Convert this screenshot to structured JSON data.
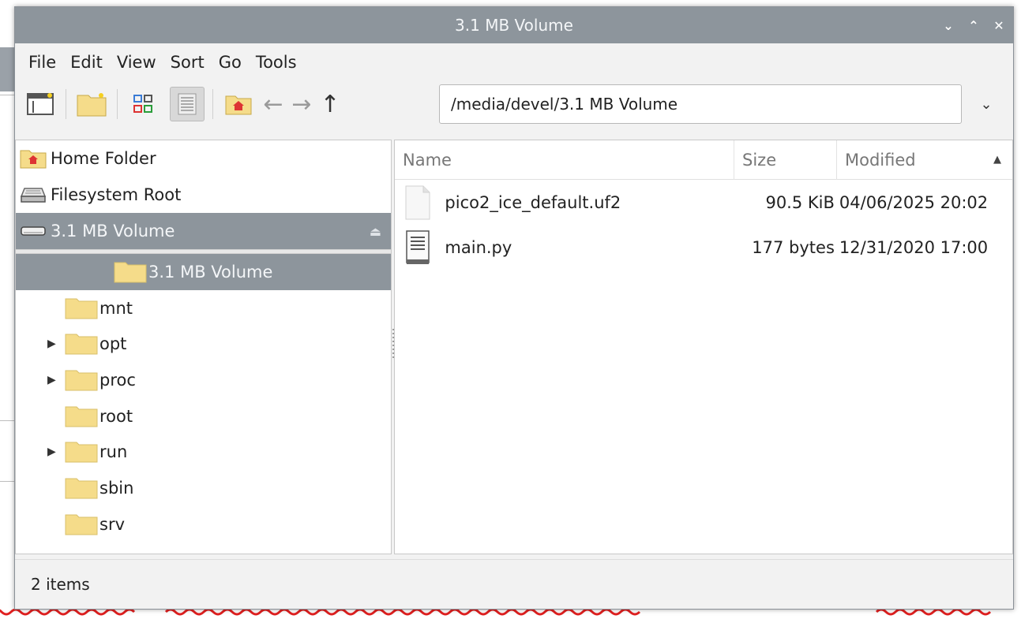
{
  "window": {
    "title": "3.1 MB Volume",
    "controls": {
      "minimize": "⌄",
      "maximize": "⌃",
      "close": "✕"
    }
  },
  "menu": [
    "File",
    "Edit",
    "View",
    "Sort",
    "Go",
    "Tools"
  ],
  "toolbar": {
    "path": "/media/devel/3.1 MB Volume",
    "dropdown": "⌄",
    "back": "←",
    "forward": "→",
    "up": "↑"
  },
  "places": [
    {
      "label": "Home Folder",
      "icon": "home-folder-icon",
      "selected": false
    },
    {
      "label": "Filesystem Root",
      "icon": "drive-icon",
      "selected": false
    },
    {
      "label": "3.1 MB Volume",
      "icon": "removable-drive-icon",
      "selected": true,
      "eject": "⏏"
    }
  ],
  "tree": [
    {
      "label": "3.1 MB Volume",
      "expandable": false,
      "selected": true
    },
    {
      "label": "mnt",
      "expandable": false,
      "selected": false
    },
    {
      "label": "opt",
      "expandable": true,
      "selected": false
    },
    {
      "label": "proc",
      "expandable": true,
      "selected": false
    },
    {
      "label": "root",
      "expandable": false,
      "selected": false
    },
    {
      "label": "run",
      "expandable": true,
      "selected": false
    },
    {
      "label": "sbin",
      "expandable": false,
      "selected": false
    },
    {
      "label": "srv",
      "expandable": false,
      "selected": false
    }
  ],
  "columns": {
    "name": "Name",
    "size": "Size",
    "modified": "Modified",
    "sort_indicator": "▲"
  },
  "files": [
    {
      "name": "pico2_ice_default.uf2",
      "size": "90.5 KiB",
      "modified": "04/06/2025 20:02",
      "icon": "blank-file-icon"
    },
    {
      "name": "main.py",
      "size": "177 bytes",
      "modified": "12/31/2020 17:00",
      "icon": "text-file-icon"
    }
  ],
  "status": "2 items",
  "colors": {
    "accent": "#8d959c",
    "folder": "#f5dc8a"
  }
}
